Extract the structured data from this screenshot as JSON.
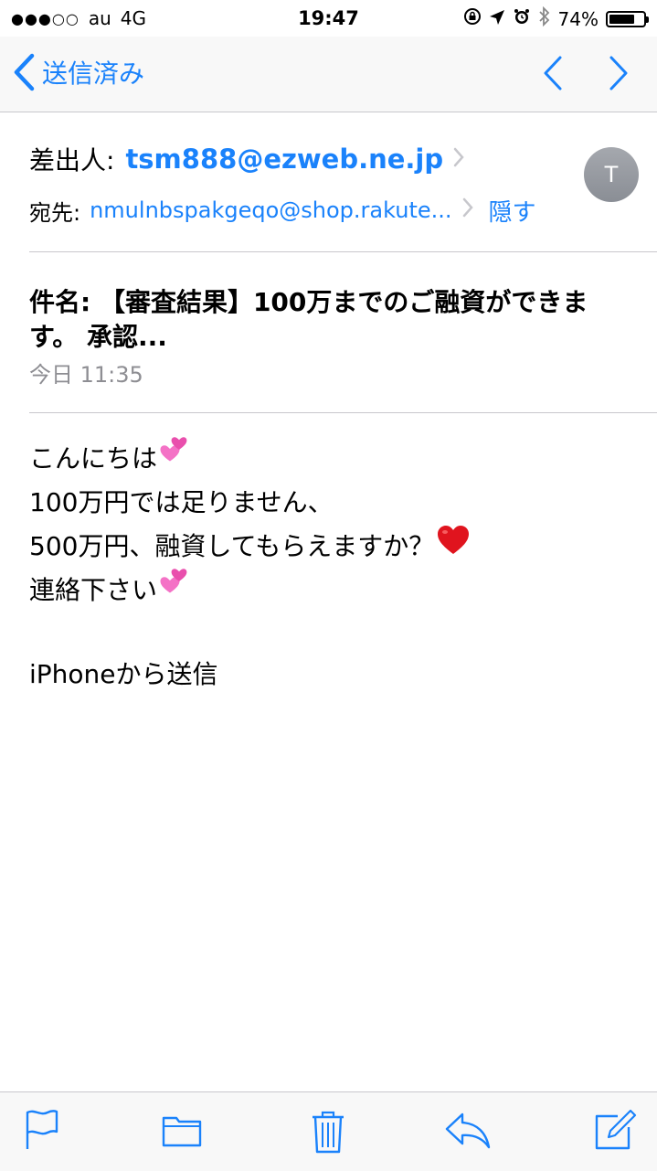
{
  "status_bar": {
    "signal": "●●●○○",
    "carrier": "au",
    "network": "4G",
    "time": "19:47",
    "battery_percent": "74%",
    "battery_level": 0.74
  },
  "nav": {
    "back_label": "送信済み"
  },
  "header": {
    "from_label": "差出人:",
    "from_value": "tsm888@ezweb.ne.jp",
    "to_label": "宛先:",
    "to_value": "nmulnbspakgeqo@shop.rakute...",
    "hide_label": "隠す",
    "avatar_initial": "T"
  },
  "subject": {
    "text": "件名: 【審査結果】100万までのご融資ができます。 承認..."
  },
  "date": "今日 11:35",
  "body": {
    "lines": [
      "こんにちは",
      "100万円では足りません、",
      "500万円、融資してもらえますか？",
      "連絡下さい"
    ],
    "signature": "iPhoneから送信"
  },
  "colors": {
    "accent": "#1a82fb",
    "separator": "#c8c7cc",
    "secondary_text": "#8e8e93"
  },
  "icons": {
    "back": "chevron-left-icon",
    "prev": "chevron-up-icon",
    "next": "chevron-down-icon",
    "flag": "flag-icon",
    "folder": "folder-icon",
    "trash": "trash-icon",
    "reply": "reply-icon",
    "compose": "compose-icon"
  }
}
